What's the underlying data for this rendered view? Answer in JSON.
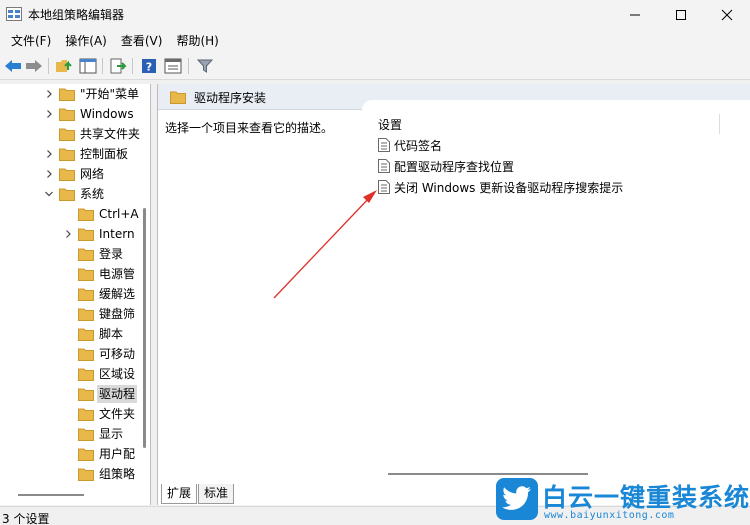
{
  "window": {
    "title": "本地组策略编辑器"
  },
  "menu": [
    "文件(F)",
    "操作(A)",
    "查看(V)",
    "帮助(H)"
  ],
  "tree": [
    {
      "label": "\"开始\"菜单",
      "expander": true,
      "expanded": false
    },
    {
      "label": "Windows",
      "expander": true,
      "expanded": false
    },
    {
      "label": "共享文件夹",
      "expander": false,
      "expanded": false
    },
    {
      "label": "控制面板",
      "expander": true,
      "expanded": false
    },
    {
      "label": "网络",
      "expander": true,
      "expanded": false
    },
    {
      "label": "系统",
      "expander": true,
      "expanded": true
    },
    {
      "label": "Ctrl+A",
      "expander": false,
      "expanded": false
    },
    {
      "label": "Intern",
      "expander": true,
      "expanded": false
    },
    {
      "label": "登录",
      "expander": false,
      "expanded": false
    },
    {
      "label": "电源管",
      "expander": false,
      "expanded": false
    },
    {
      "label": "缓解选",
      "expander": false,
      "expanded": false
    },
    {
      "label": "键盘筛",
      "expander": false,
      "expanded": false
    },
    {
      "label": "脚本",
      "expander": false,
      "expanded": false
    },
    {
      "label": "可移动",
      "expander": false,
      "expanded": false
    },
    {
      "label": "区域设",
      "expander": false,
      "expanded": false
    },
    {
      "label": "驱动程",
      "expander": false,
      "expanded": false,
      "selected": true
    },
    {
      "label": "文件夹",
      "expander": false,
      "expanded": false
    },
    {
      "label": "显示",
      "expander": false,
      "expanded": false
    },
    {
      "label": "用户配",
      "expander": false,
      "expanded": false
    },
    {
      "label": "组策略",
      "expander": false,
      "expanded": false
    }
  ],
  "details": {
    "header_title": "驱动程序安装",
    "description": "选择一个项目来查看它的描述。",
    "column_header": "设置",
    "settings": [
      "代码签名",
      "配置驱动程序查找位置",
      "关闭 Windows 更新设备驱动程序搜索提示"
    ]
  },
  "tabs": [
    "扩展",
    "标准"
  ],
  "status": {
    "text": "3 个设置"
  },
  "watermark": {
    "title": "白云一键重装系统",
    "url": "www.baiyunxitong.com"
  },
  "colors": {
    "accent": "#1a87d6",
    "arrow": "#e0302a",
    "folder": "#e8b84a"
  }
}
